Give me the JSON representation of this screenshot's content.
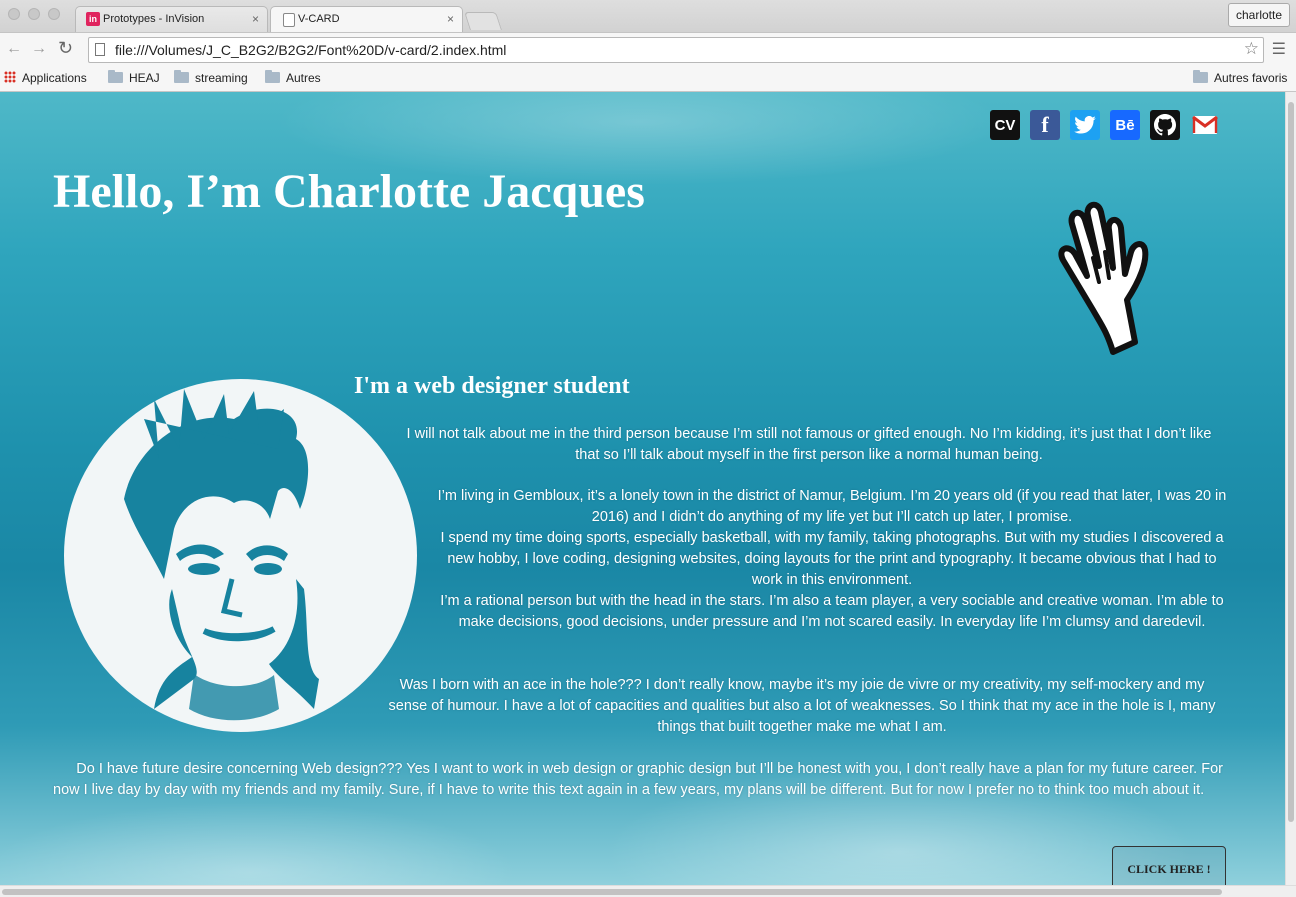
{
  "browser": {
    "tabs": [
      {
        "favicon": "in",
        "title": "Prototypes - InVision",
        "close": "×"
      },
      {
        "title": "V-CARD",
        "close": "×"
      }
    ],
    "profile": "charlotte",
    "url": "file:///Volumes/J_C_B2G2/B2G2/Font%20D/v-card/2.index.html",
    "bookmarks": [
      {
        "label": "Applications"
      },
      {
        "label": "HEAJ"
      },
      {
        "label": "streaming"
      },
      {
        "label": "Autres"
      }
    ],
    "other_bookmarks": "Autres favoris"
  },
  "page": {
    "title": "Hello, I’m Charlotte Jacques",
    "subtitle": "I'm a web designer student",
    "socials": [
      {
        "label": "CV",
        "icon": "cv-icon"
      },
      {
        "label": "f",
        "icon": "facebook-icon"
      },
      {
        "icon": "twitter-icon"
      },
      {
        "label": "Bē",
        "icon": "behance-icon"
      },
      {
        "icon": "github-icon"
      },
      {
        "icon": "gmail-icon"
      }
    ],
    "paragraphs": {
      "p1": "I will not talk about me in the third person because I’m still not famous or gifted enough. No I’m kidding, it’s just that I don’t like that so I’ll talk about myself in the first person like a normal human being.",
      "p2a": "I’m living in Gembloux, it’s a lonely town in the district of Namur, Belgium. I’m 20 years old (if you read that later, I was 20 in 2016) and I didn’t do anything of my life yet but I’ll catch up later, I promise.",
      "p2b": "I spend my time doing sports, especially basketball, with my family, taking photographs. But with my studies I discovered a new hobby, I love coding, designing websites, doing layouts for the print and typography. It became obvious that I had to work in this environment.",
      "p2c": "I’m a rational person but with the head in the stars. I’m also a team player, a very sociable and creative woman. I’m able to make decisions, good decisions, under pressure and I’m not scared easily. In everyday life I’m clumsy and daredevil.",
      "p3": "Was I born with an ace in the hole??? I don’t really know, maybe it’s my joie de vivre or my creativity, my self-mockery and my sense of humour. I have a lot of capacities and qualities but also a lot of weaknesses. So I think that my ace in the hole is I, many things that built together make me what I am.",
      "p4": "Do I have future desire concerning Web design??? Yes I want to work in web design or graphic design but I’ll be honest with you, I don’t really have a plan for my future career. For now I live day by day with my friends and my family. Sure, if I have to write this text again in a few years, my plans will be different. But for now I prefer no to think too much about it."
    },
    "cta": "CLICK HERE !"
  }
}
